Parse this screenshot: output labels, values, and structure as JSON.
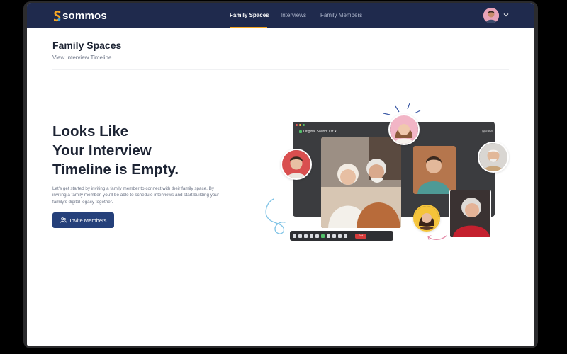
{
  "app": {
    "brand": "sommos",
    "colors": {
      "navbar": "#1f2a4d",
      "accent": "#f5a623",
      "button": "#25407a",
      "text_dark": "#1c2333"
    }
  },
  "nav": {
    "tabs": [
      {
        "label": "Family Spaces",
        "active": true
      },
      {
        "label": "Interviews",
        "active": false
      },
      {
        "label": "Family Members",
        "active": false
      }
    ],
    "user_menu": {
      "avatar": "avatar-icon",
      "dropdown": "chevron-down-icon"
    }
  },
  "header": {
    "title": "Family Spaces",
    "breadcrumb": "View Interview Timeline"
  },
  "empty_state": {
    "headline_lines": [
      "Looks Like",
      "Your Interview",
      "Timeline is Empty."
    ],
    "description": "Let's get started by inviting a family member to connect with their family space. By inviting a family member, you'll be able to schedule interviews and start building your family's digital legacy together.",
    "cta_label": "Invite Members",
    "cta_icon": "users-icon"
  },
  "illustration": {
    "call_window": {
      "audio_label": "Original Sound: Off",
      "view_label": "View",
      "end_label": "End"
    }
  }
}
